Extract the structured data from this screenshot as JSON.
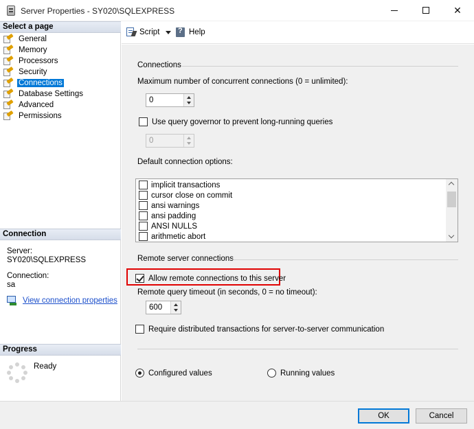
{
  "window": {
    "title": "Server Properties - SY020\\SQLEXPRESS",
    "minimize_label": "—",
    "close_label": "✕"
  },
  "left_pane": {
    "select_page_header": "Select a page",
    "pages": [
      {
        "label": "General",
        "selected": false
      },
      {
        "label": "Memory",
        "selected": false
      },
      {
        "label": "Processors",
        "selected": false
      },
      {
        "label": "Security",
        "selected": false
      },
      {
        "label": "Connections",
        "selected": true
      },
      {
        "label": "Database Settings",
        "selected": false
      },
      {
        "label": "Advanced",
        "selected": false
      },
      {
        "label": "Permissions",
        "selected": false
      }
    ],
    "connection_header": "Connection",
    "server_label": "Server:",
    "server_value": "SY020\\SQLEXPRESS",
    "connection_label": "Connection:",
    "connection_value": "sa",
    "view_connection_link": "View connection properties",
    "progress_header": "Progress",
    "progress_status": "Ready"
  },
  "toolbar": {
    "script_label": "Script",
    "help_label": "Help"
  },
  "connections": {
    "group_title": "Connections",
    "max_connections_label": "Maximum number of concurrent connections (0 = unlimited):",
    "max_connections_value": "0",
    "query_governor_label": "Use query governor to prevent long-running queries",
    "query_governor_checked": false,
    "query_governor_value": "0",
    "default_options_label": "Default connection options:",
    "default_options": [
      {
        "label": "implicit transactions",
        "checked": false
      },
      {
        "label": "cursor close on commit",
        "checked": false
      },
      {
        "label": "ansi warnings",
        "checked": false
      },
      {
        "label": "ansi padding",
        "checked": false
      },
      {
        "label": "ANSI NULLS",
        "checked": false
      },
      {
        "label": "arithmetic abort",
        "checked": false
      }
    ]
  },
  "remote": {
    "group_title": "Remote server connections",
    "allow_remote_label": "Allow remote connections to this server",
    "allow_remote_checked": true,
    "timeout_label": "Remote query timeout (in seconds, 0 = no timeout):",
    "timeout_value": "600",
    "distributed_label": "Require distributed transactions for server-to-server communication",
    "distributed_checked": false
  },
  "values_view": {
    "configured_label": "Configured values",
    "running_label": "Running values",
    "selected": "configured"
  },
  "buttons": {
    "ok_label": "OK",
    "cancel_label": "Cancel"
  },
  "colors": {
    "selection": "#0078d7",
    "highlight_border": "#e00000",
    "link": "#1a4ecb"
  }
}
